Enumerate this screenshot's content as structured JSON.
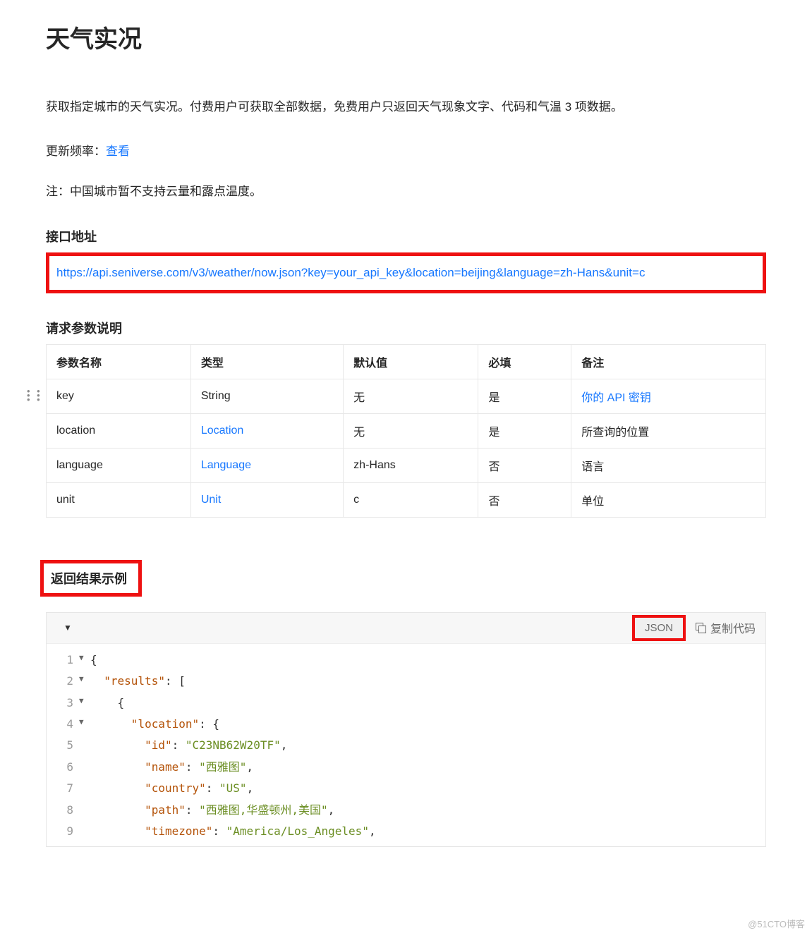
{
  "title": "天气实况",
  "intro": "获取指定城市的天气实况。付费用户可获取全部数据，免费用户只返回天气现象文字、代码和气温 3 项数据。",
  "update_label": "更新频率：",
  "update_link": "查看",
  "note": "注：中国城市暂不支持云量和露点温度。",
  "section_api": "接口地址",
  "api_url": "https://api.seniverse.com/v3/weather/now.json?key=your_api_key&location=beijing&language=zh-Hans&unit=c",
  "section_params": "请求参数说明",
  "params_header": [
    "参数名称",
    "类型",
    "默认值",
    "必填",
    "备注"
  ],
  "params_rows": [
    {
      "name": "key",
      "type": "String",
      "type_link": false,
      "default": "无",
      "required": "是",
      "remark": "你的 API 密钥",
      "remark_link": true
    },
    {
      "name": "location",
      "type": "Location",
      "type_link": true,
      "default": "无",
      "required": "是",
      "remark": "所查询的位置",
      "remark_link": false
    },
    {
      "name": "language",
      "type": "Language",
      "type_link": true,
      "default": "zh-Hans",
      "required": "否",
      "remark": "语言",
      "remark_link": false
    },
    {
      "name": "unit",
      "type": "Unit",
      "type_link": true,
      "default": "c",
      "required": "否",
      "remark": "单位",
      "remark_link": false
    }
  ],
  "section_result": "返回结果示例",
  "code_lang": "JSON",
  "copy_label": "复制代码",
  "code_lines": [
    {
      "n": "1",
      "fold": true,
      "tokens": [
        [
          "p",
          "{"
        ]
      ]
    },
    {
      "n": "2",
      "fold": true,
      "tokens": [
        [
          "p",
          "  "
        ],
        [
          "k",
          "\"results\""
        ],
        [
          "p",
          ": ["
        ]
      ]
    },
    {
      "n": "3",
      "fold": true,
      "tokens": [
        [
          "p",
          "    {"
        ]
      ]
    },
    {
      "n": "4",
      "fold": true,
      "tokens": [
        [
          "p",
          "      "
        ],
        [
          "k",
          "\"location\""
        ],
        [
          "p",
          ": {"
        ]
      ]
    },
    {
      "n": "5",
      "fold": false,
      "tokens": [
        [
          "p",
          "        "
        ],
        [
          "k",
          "\"id\""
        ],
        [
          "p",
          ": "
        ],
        [
          "s",
          "\"C23NB62W20TF\""
        ],
        [
          "p",
          ","
        ]
      ]
    },
    {
      "n": "6",
      "fold": false,
      "tokens": [
        [
          "p",
          "        "
        ],
        [
          "k",
          "\"name\""
        ],
        [
          "p",
          ": "
        ],
        [
          "s",
          "\"西雅图\""
        ],
        [
          "p",
          ","
        ]
      ]
    },
    {
      "n": "7",
      "fold": false,
      "tokens": [
        [
          "p",
          "        "
        ],
        [
          "k",
          "\"country\""
        ],
        [
          "p",
          ": "
        ],
        [
          "s",
          "\"US\""
        ],
        [
          "p",
          ","
        ]
      ]
    },
    {
      "n": "8",
      "fold": false,
      "tokens": [
        [
          "p",
          "        "
        ],
        [
          "k",
          "\"path\""
        ],
        [
          "p",
          ": "
        ],
        [
          "s",
          "\"西雅图,华盛顿州,美国\""
        ],
        [
          "p",
          ","
        ]
      ]
    },
    {
      "n": "9",
      "fold": false,
      "tokens": [
        [
          "p",
          "        "
        ],
        [
          "k",
          "\"timezone\""
        ],
        [
          "p",
          ": "
        ],
        [
          "s",
          "\"America/Los_Angeles\""
        ],
        [
          "p",
          ","
        ]
      ]
    }
  ],
  "watermark": "@51CTO博客"
}
